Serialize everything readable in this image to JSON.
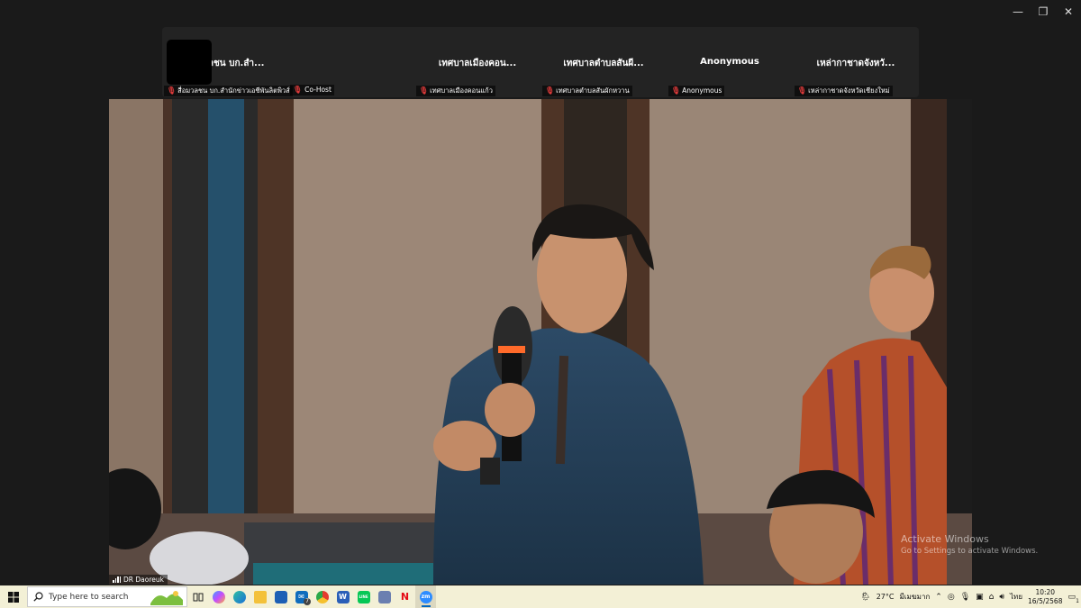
{
  "window_controls": {
    "minimize": "—",
    "restore": "❐",
    "close": "✕"
  },
  "participants": [
    {
      "title": "สื่อมวลชน บก.สำ...",
      "label": "สื่อมวลชน บก.สำนักข่าวเอชีพันลิตพิวส์"
    },
    {
      "title": "",
      "label": "",
      "cohost_label": "Co-Host"
    },
    {
      "title": "เทศบาลเมืองคอน...",
      "label": "เทศบาลเมืองคอนแก้ว"
    },
    {
      "title": "เทศบาลตำบลสันผี...",
      "label": "เทศบาลตำบลสันผักหวาน"
    },
    {
      "title": "Anonymous",
      "label": "Anonymous"
    },
    {
      "title": "เหล่ากาชาดจังหวั...",
      "label": "เหล่ากาชาดจังหวัดเชียงใหม่"
    }
  ],
  "main_video": {
    "speaker_name": "DR Daoreuk"
  },
  "watermark": {
    "line1": "Activate Windows",
    "line2": "Go to Settings to activate Windows."
  },
  "taskbar": {
    "search_placeholder": "Type here to search",
    "apps": [
      {
        "icon": "task-view-icon"
      },
      {
        "icon": "copilot-icon"
      },
      {
        "icon": "edge-icon"
      },
      {
        "icon": "file-explorer-icon"
      },
      {
        "icon": "store-icon"
      },
      {
        "icon": "mail-icon",
        "badge": "7"
      },
      {
        "icon": "chrome-icon"
      },
      {
        "icon": "word-icon",
        "letter": "W"
      },
      {
        "icon": "line-icon",
        "letter": "LINE"
      },
      {
        "icon": "photos-icon"
      },
      {
        "icon": "netflix-icon",
        "letter": "N"
      },
      {
        "icon": "zoom-icon",
        "letter": "zm"
      }
    ],
    "weather": {
      "temp": "27°C",
      "condition": "มีเมฆมาก"
    },
    "language": "ไทย",
    "time": "10:20",
    "date": "16/5/2568",
    "notification_count": "1"
  },
  "colors": {
    "taskbar_bg": "#f3f0d6",
    "mute_red": "#e23b3b",
    "accent": "#0067c0"
  }
}
